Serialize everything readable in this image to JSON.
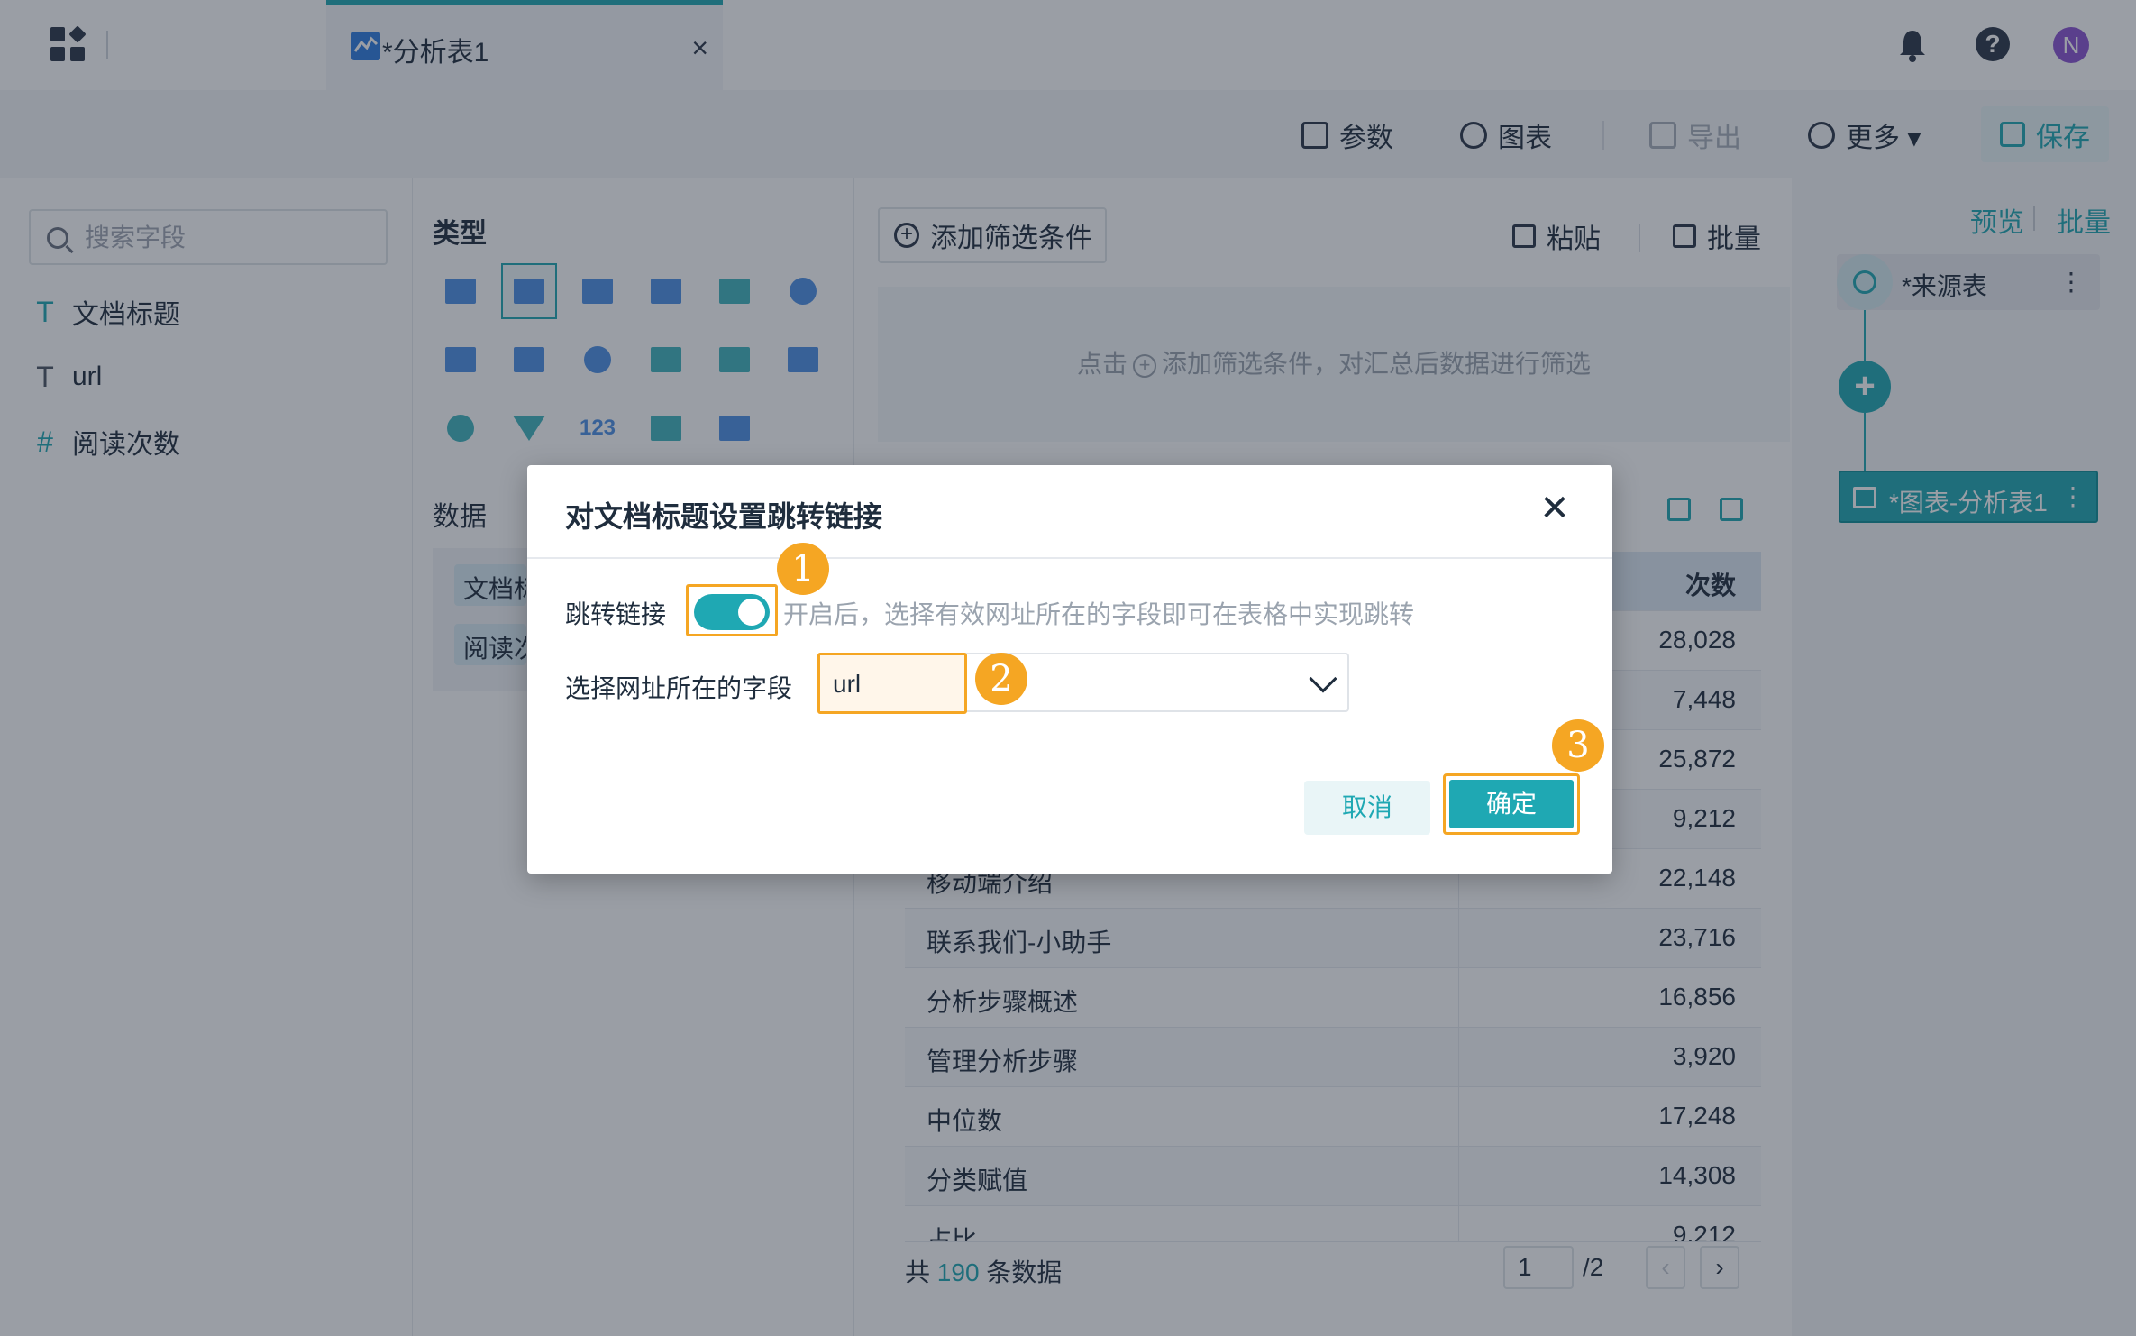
{
  "topbar": {
    "tab_title": "*分析表1",
    "tab_close": "×",
    "help_label": "?",
    "avatar_initial": "N"
  },
  "toolbar": {
    "params": "参数",
    "chart": "图表",
    "export": "导出",
    "more": "更多 ▾",
    "save": "保存"
  },
  "fields": {
    "search_placeholder": "搜索字段",
    "items": [
      {
        "type_glyph": "T",
        "label": "文档标题"
      },
      {
        "type_glyph": "T",
        "label": "url"
      },
      {
        "type_glyph": "#",
        "label": "阅读次数"
      }
    ]
  },
  "config": {
    "type_label": "类型",
    "data_label": "数据",
    "chips": [
      "文档标题",
      "阅读次数"
    ],
    "number_icon_text": "123"
  },
  "main": {
    "add_filter": "添加筛选条件",
    "paste": "粘贴",
    "batch": "批量",
    "filter_hint_prefix": "点击",
    "filter_hint_suffix": "添加筛选条件，对汇总后数据进行筛选",
    "table": {
      "header_right": "次数",
      "rows": [
        {
          "title": "",
          "value": "28,028"
        },
        {
          "title": "",
          "value": "7,448"
        },
        {
          "title": "",
          "value": "25,872"
        },
        {
          "title": "",
          "value": "9,212"
        },
        {
          "title": "移动端介绍",
          "value": "22,148"
        },
        {
          "title": "联系我们-小助手",
          "value": "23,716"
        },
        {
          "title": "分析步骤概述",
          "value": "16,856"
        },
        {
          "title": "管理分析步骤",
          "value": "3,920"
        },
        {
          "title": "中位数",
          "value": "17,248"
        },
        {
          "title": "分类赋值",
          "value": "14,308"
        },
        {
          "title": "占比",
          "value": "9,212"
        }
      ]
    },
    "pager": {
      "total_prefix": "共",
      "total_count": "190",
      "total_suffix": "条数据",
      "current_page": "1",
      "of_pages": "/2",
      "prev": "‹",
      "next": "›"
    }
  },
  "flow": {
    "preview": "预览",
    "batch": "批量",
    "source_node": "*来源表",
    "chart_node": "*图表-分析表1",
    "more_glyph": "⋮",
    "add_glyph": "+"
  },
  "dialog": {
    "title": "对文档标题设置跳转链接",
    "close": "✕",
    "link_label": "跳转链接",
    "link_enabled": true,
    "hint": "开启后，选择有效网址所在的字段即可在表格中实现跳转",
    "field_label": "选择网址所在的字段",
    "field_value": "url",
    "cancel": "取消",
    "ok": "确定",
    "badges": [
      "1",
      "2",
      "3"
    ]
  },
  "colors": {
    "accent": "#1fa8b3",
    "highlight": "#f5a623",
    "avatar": "#8b52d1"
  }
}
